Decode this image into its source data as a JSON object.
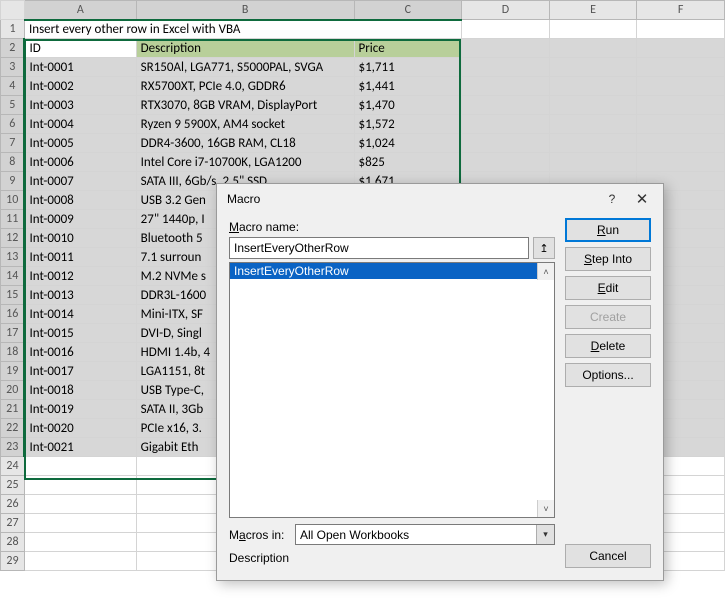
{
  "sheet": {
    "columns": [
      "A",
      "B",
      "C",
      "D",
      "E",
      "F"
    ],
    "row_numbers": [
      1,
      2,
      3,
      4,
      5,
      6,
      7,
      8,
      9,
      10,
      11,
      12,
      13,
      14,
      15,
      16,
      17,
      18,
      19,
      20,
      21,
      22,
      23,
      24,
      25,
      26,
      27,
      28,
      29
    ],
    "title": "Insert every other row in Excel with VBA",
    "headers": {
      "id": "ID",
      "desc": "Description",
      "price": "Price"
    },
    "rows": [
      {
        "id": "Int-0001",
        "desc": "SR150Al, LGA771, S5000PAL, SVGA",
        "price": "$1,711"
      },
      {
        "id": "Int-0002",
        "desc": "RX5700XT, PCIe 4.0, GDDR6",
        "price": "$1,441"
      },
      {
        "id": "Int-0003",
        "desc": "RTX3070, 8GB VRAM, DisplayPort",
        "price": "$1,470"
      },
      {
        "id": "Int-0004",
        "desc": "Ryzen 9 5900X, AM4 socket",
        "price": "$1,572"
      },
      {
        "id": "Int-0005",
        "desc": "DDR4-3600, 16GB RAM, CL18",
        "price": "$1,024"
      },
      {
        "id": "Int-0006",
        "desc": "Intel Core i7-10700K, LGA1200",
        "price": "$825"
      },
      {
        "id": "Int-0007",
        "desc": "SATA III, 6Gb/s, 2.5\" SSD",
        "price": "$1,671"
      },
      {
        "id": "Int-0008",
        "desc": "USB 3.2 Gen",
        "price": ""
      },
      {
        "id": "Int-0009",
        "desc": "27\" 1440p, I",
        "price": ""
      },
      {
        "id": "Int-0010",
        "desc": "Bluetooth 5",
        "price": ""
      },
      {
        "id": "Int-0011",
        "desc": "7.1 surroun",
        "price": ""
      },
      {
        "id": "Int-0012",
        "desc": "M.2 NVMe s",
        "price": ""
      },
      {
        "id": "Int-0013",
        "desc": "DDR3L-1600",
        "price": ""
      },
      {
        "id": "Int-0014",
        "desc": "Mini-ITX, SF",
        "price": ""
      },
      {
        "id": "Int-0015",
        "desc": "DVI-D, Singl",
        "price": ""
      },
      {
        "id": "Int-0016",
        "desc": "HDMI 1.4b, 4",
        "price": ""
      },
      {
        "id": "Int-0017",
        "desc": "LGA1151, 8t",
        "price": ""
      },
      {
        "id": "Int-0018",
        "desc": "USB Type-C,",
        "price": ""
      },
      {
        "id": "Int-0019",
        "desc": "SATA II, 3Gb",
        "price": ""
      },
      {
        "id": "Int-0020",
        "desc": "PCIe x16, 3.",
        "price": ""
      },
      {
        "id": "Int-0021",
        "desc": "Gigabit Eth",
        "price": ""
      }
    ]
  },
  "dialog": {
    "title": "Macro",
    "macro_name_label": "Macro name:",
    "macro_name_value": "InsertEveryOtherRow",
    "list": {
      "selected": "InsertEveryOtherRow"
    },
    "macros_in_label": "Macros in:",
    "macros_in_value": "All Open Workbooks",
    "description_label": "Description",
    "buttons": {
      "run": "Run",
      "step_into": "Step Into",
      "edit": "Edit",
      "create": "Create",
      "delete": "Delete",
      "options": "Options...",
      "cancel": "Cancel"
    }
  }
}
